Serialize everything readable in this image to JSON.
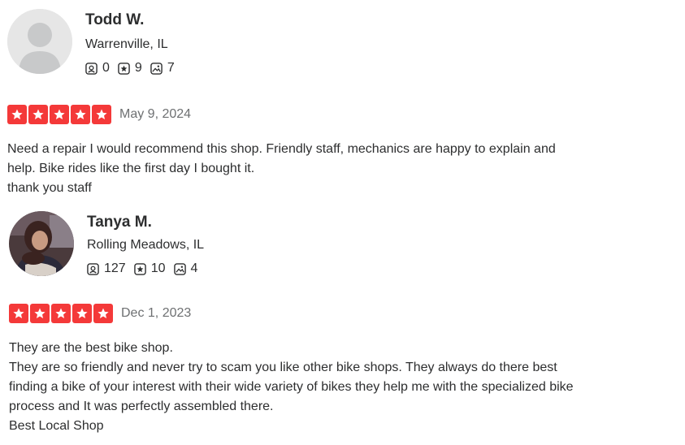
{
  "reviews": [
    {
      "user": {
        "name": "Todd W.",
        "location": "Warrenville, IL",
        "friends": "0",
        "reviews": "9",
        "photos": "7",
        "avatar": "default-avatar"
      },
      "rating": 5,
      "date": "May 9, 2024",
      "text": "Need a repair I would recommend this shop. Friendly staff, mechanics are happy to explain and\nhelp. Bike rides like the first day I bought it.\nthank you staff"
    },
    {
      "user": {
        "name": "Tanya M.",
        "location": "Rolling Meadows, IL",
        "friends": "127",
        "reviews": "10",
        "photos": "4",
        "avatar": "photo-avatar"
      },
      "rating": 5,
      "date": "Dec 1, 2023",
      "text": "They are the best bike shop.\nThey are so friendly and never try to scam you like other bike shops. They always do there best\nfinding a bike of your interest with their wide variety of bikes they help me with the specialized bike\nprocess and It was perfectly assembled there.\nBest Local Shop"
    }
  ],
  "colors": {
    "star_red": "#f43939",
    "text": "#2d2e2f",
    "muted": "#6e7072"
  },
  "icons": {
    "friends": "friends-icon",
    "reviews": "star-badge-icon",
    "photos": "photo-icon",
    "rating": "star-icon"
  }
}
